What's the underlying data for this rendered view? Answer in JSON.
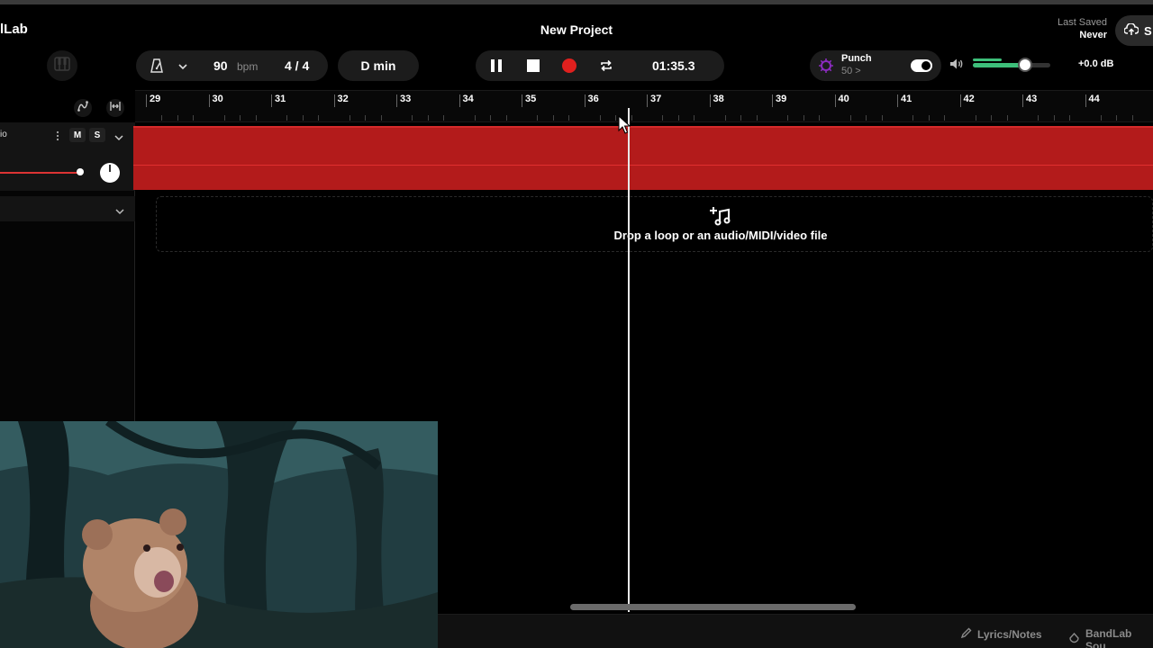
{
  "header": {
    "brand": "lLab",
    "project_title": "New Project",
    "last_saved_label": "Last Saved",
    "last_saved_value": "Never",
    "save_label": "S"
  },
  "toolbar": {
    "bpm_value": "90",
    "bpm_unit": "bpm",
    "time_signature": "4 / 4",
    "key": "D min",
    "time_display": "01:35.3",
    "punch_label": "Punch",
    "punch_sub": "50 >",
    "punch_enabled": true,
    "volume_fraction": 0.68,
    "master_db": "+0.0 dB"
  },
  "ruler": {
    "bars": [
      "29",
      "30",
      "31",
      "32",
      "33",
      "34",
      "35",
      "36",
      "37",
      "38",
      "39",
      "40",
      "41",
      "42",
      "43",
      "44"
    ]
  },
  "track": {
    "name": "io",
    "mute_label": "M",
    "solo_label": "S",
    "clip_color": "#b31b1b"
  },
  "drop_zone": {
    "text": "Drop a loop or an audio/MIDI/video file"
  },
  "footer": {
    "lyrics_label": "Lyrics/Notes",
    "sounds_label": "BandLab Sou"
  },
  "colors": {
    "record": "#e0201e",
    "volume": "#3dbf7a",
    "punch_icon": "#8a2bbd"
  }
}
